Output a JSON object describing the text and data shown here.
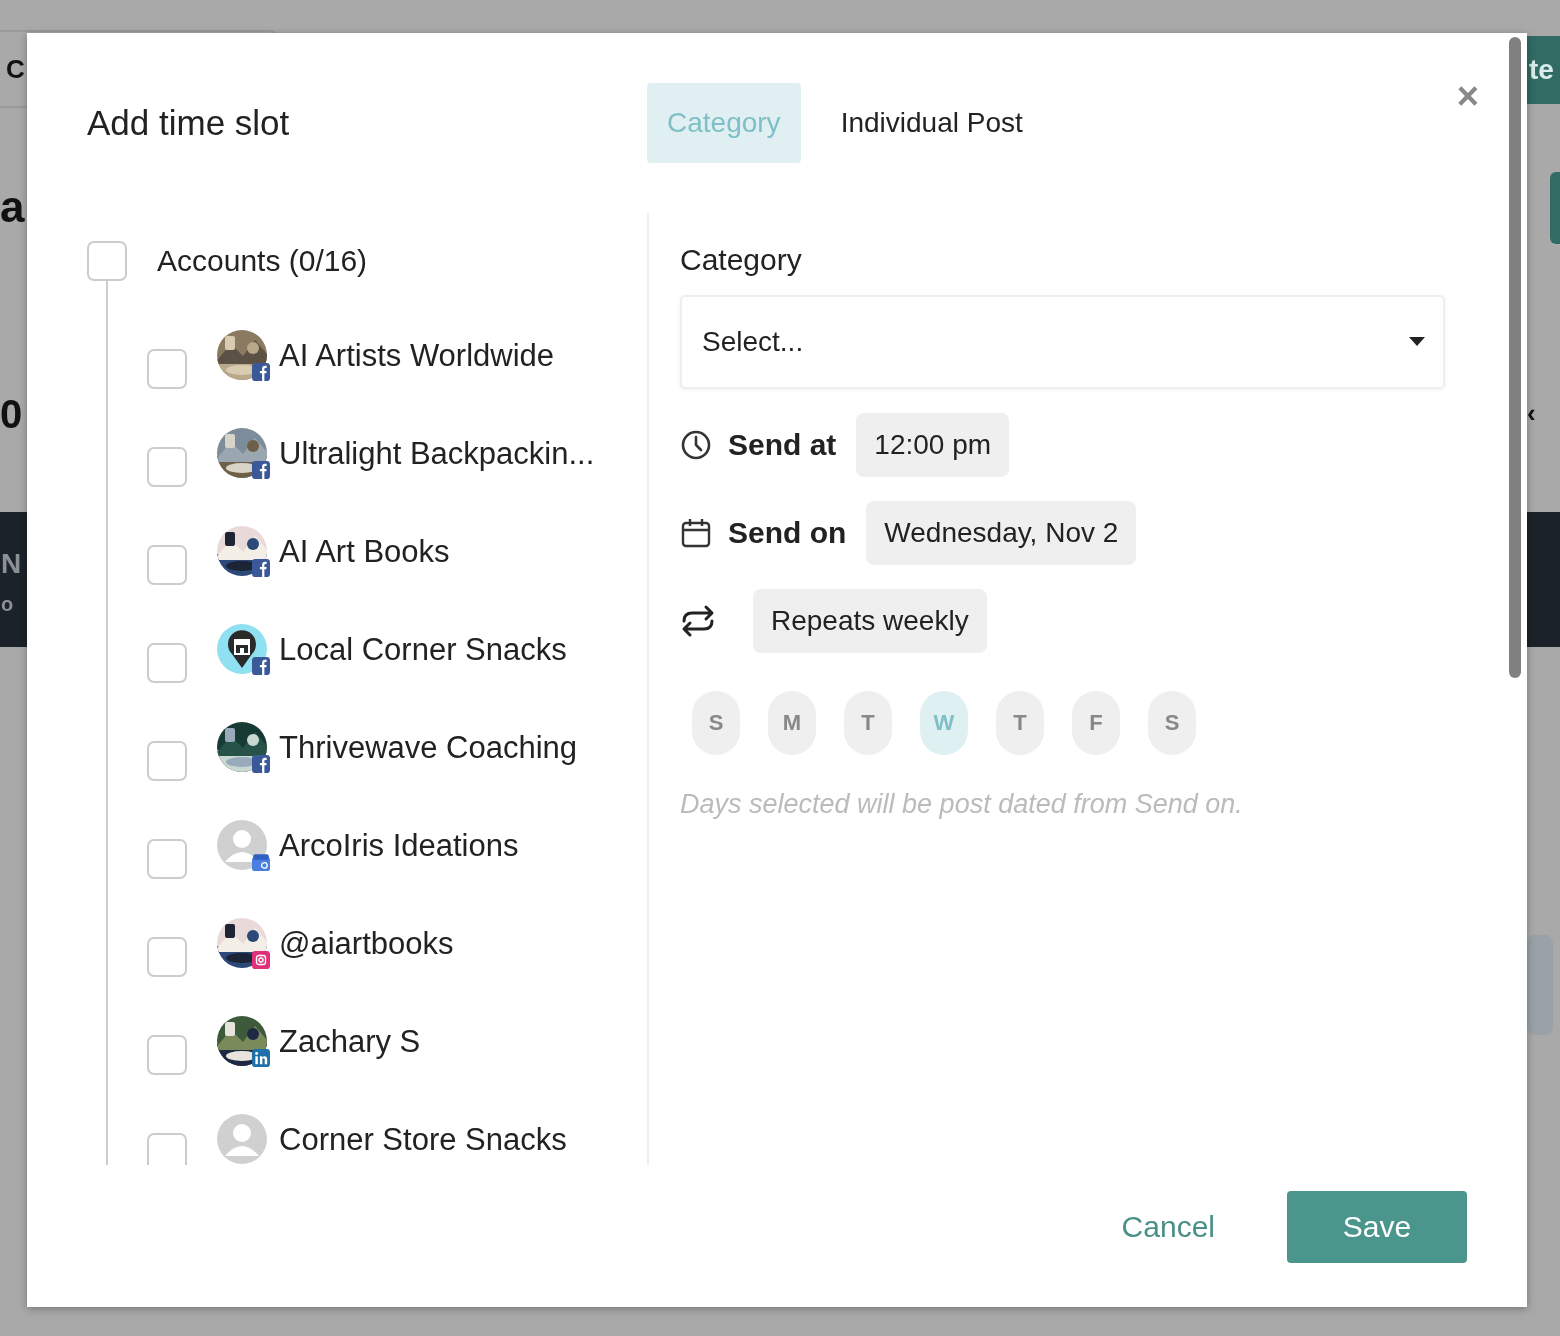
{
  "background_fragments": [
    "C",
    "a",
    "0",
    "N",
    "o",
    "te",
    "‹"
  ],
  "dialog": {
    "title": "Add time slot",
    "close": "×",
    "tabs": [
      {
        "label": "Category",
        "selected": true
      },
      {
        "label": "Individual Post",
        "selected": false
      }
    ],
    "accounts": {
      "label": "Accounts (0/16)",
      "checked": false,
      "items": [
        {
          "name": "AI Artists Worldwide",
          "checked": false,
          "badge": {
            "kind": "facebook"
          }
        },
        {
          "name": "Ultralight Backpackin...",
          "checked": false,
          "badge": {
            "kind": "facebook"
          }
        },
        {
          "name": "AI Art Books",
          "checked": false,
          "badge": {
            "kind": "facebook"
          }
        },
        {
          "name": "Local Corner Snacks",
          "checked": false,
          "avatar": {
            "kind": "store"
          },
          "badge": {
            "kind": "facebook"
          }
        },
        {
          "name": "Thrivewave Coaching",
          "checked": false,
          "badge": {
            "kind": "facebook"
          }
        },
        {
          "name": "ArcoIris Ideations",
          "checked": false,
          "avatar": {
            "kind": "default"
          },
          "badge": {
            "kind": "google"
          }
        },
        {
          "name": "@aiartbooks",
          "checked": false,
          "badge": {
            "kind": "instagram"
          }
        },
        {
          "name": "Zachary S",
          "checked": false,
          "badge": {
            "kind": "linkedin"
          }
        },
        {
          "name": "Corner Store Snacks",
          "checked": false,
          "avatar": {
            "kind": "default"
          }
        }
      ]
    },
    "category": {
      "label": "Category",
      "placeholder": "Select..."
    },
    "send_at": {
      "label": "Send at",
      "value": "12:00 pm"
    },
    "send_on": {
      "label": "Send on",
      "value": "Wednesday, Nov 2"
    },
    "repeat": {
      "value": "Repeats weekly"
    },
    "days": [
      {
        "label": "S",
        "selected": false
      },
      {
        "label": "M",
        "selected": false
      },
      {
        "label": "T",
        "selected": false
      },
      {
        "label": "W",
        "selected": true
      },
      {
        "label": "T",
        "selected": false
      },
      {
        "label": "F",
        "selected": false
      },
      {
        "label": "S",
        "selected": false
      }
    ],
    "hint": "Days selected will be post dated from Send on.",
    "buttons": {
      "cancel": "Cancel",
      "save": "Save"
    }
  }
}
